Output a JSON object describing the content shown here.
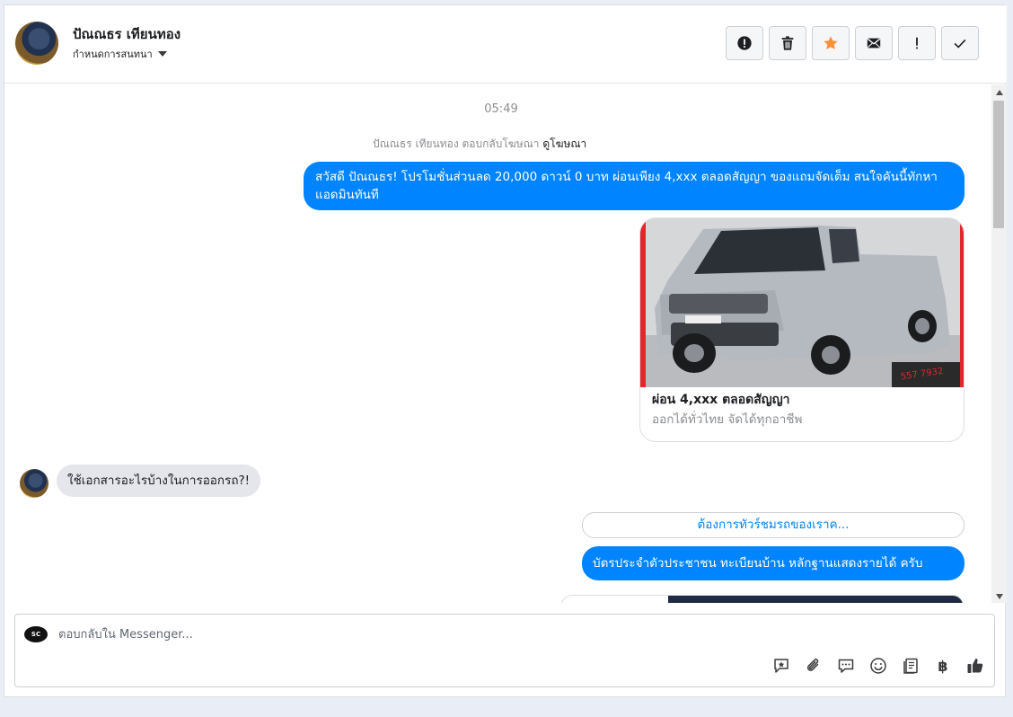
{
  "header": {
    "contact_name": "ปัณณธร เทียนทอง",
    "assign_label": "กำหนดการสนทนา"
  },
  "toolbar": {
    "buttons": [
      {
        "name": "spam",
        "icon": "exclamation-circle-icon"
      },
      {
        "name": "delete",
        "icon": "trash-icon"
      },
      {
        "name": "star",
        "icon": "star-icon",
        "color": "#f7923b"
      },
      {
        "name": "mark-unread",
        "icon": "envelope-icon"
      },
      {
        "name": "follow-up",
        "icon": "exclamation-icon"
      },
      {
        "name": "done",
        "icon": "checkmark-icon"
      }
    ]
  },
  "messages": {
    "timestamp": "05:49",
    "ad_reply_prefix": "ปัณณธร เทียนทอง ตอบกลับโฆษณา",
    "ad_link": "ดูโฆษณา",
    "outgoing_1": "สวัสดี ปัณณธร! โปรโมชั่นส่วนลด 20,000 ดาวน์ 0 บาท ผ่อนเพียง 4,xxx ตลอดสัญญา ของแถมจัดเต็ม สนใจคันนี้ทักหาแอดมินทันที",
    "card": {
      "title": "ผ่อน 4,xxx ตลอดสัญญา",
      "subtitle": "ออกได้ทั่วไทย จัดได้ทุกอาชีพ",
      "image_phone": "557 7932"
    },
    "incoming_1": "ใช้เอกสารอะไรบ้างในการออกรถ?!",
    "quick_reply": "ต้องการทัวร์ชมรถของเราค...",
    "outgoing_2": "บัตรประจำตัวประชาชน ทะเบียนบ้าน หลักฐานแสดงรายได้ ครับ"
  },
  "composer": {
    "placeholder": "ตอบกลับใน Messenger...",
    "page_avatar_text": "SC",
    "tools": [
      "saved-reply-icon",
      "paperclip-icon",
      "chat-bubbles-icon",
      "emoji-icon",
      "document-icon",
      "baht-icon",
      "thumbs-up-icon"
    ],
    "baht_symbol": "฿"
  },
  "colors": {
    "accent": "#0084ff",
    "star": "#f7923b",
    "incoming_bubble": "#e4e6eb"
  }
}
